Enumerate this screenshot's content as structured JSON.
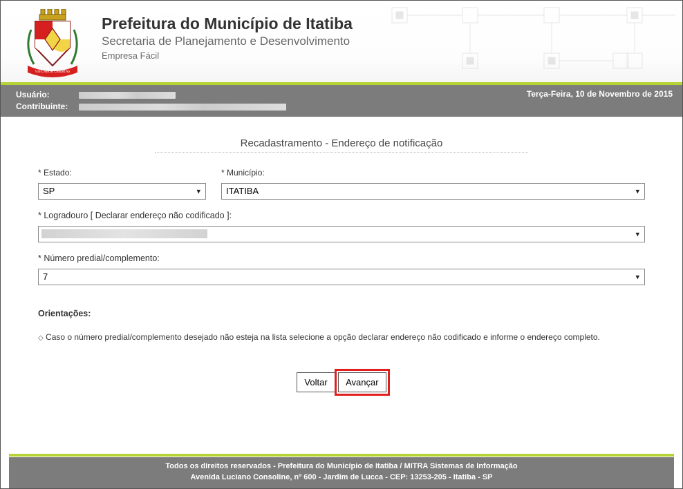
{
  "header": {
    "title": "Prefeitura do Município de Itatiba",
    "subtitle": "Secretaria de Planejamento e Desenvolvimento",
    "appname": "Empresa Fácil"
  },
  "userbar": {
    "user_label": "Usuário:",
    "contrib_label": "Contribuinte:",
    "date_text": "Terça-Feira, 10 de Novembro de 2015"
  },
  "page": {
    "title": "Recadastramento - Endereço de notificação"
  },
  "form": {
    "estado_label": "* Estado:",
    "estado_value": "SP",
    "municipio_label": "* Município:",
    "municipio_value": "ITATIBA",
    "logradouro_label": "* Logradouro [ Declarar endereço não codificado ]:",
    "logradouro_value": "",
    "numero_label": "* Número predial/complemento:",
    "numero_value": "7"
  },
  "orientacoes": {
    "heading": "Orientações:",
    "text": "Caso o número predial/complemento desejado não esteja na lista selecione a opção declarar endereço não codificado e informe o endereço completo."
  },
  "buttons": {
    "voltar": "Voltar",
    "avancar": "Avançar"
  },
  "footer": {
    "line1": "Todos os direitos reservados - Prefeitura do Município de Itatiba / MITRA Sistemas de Informação",
    "line2": "Avenida Luciano Consoline, nº 600 - Jardim de Lucca - CEP: 13253-205 - Itatiba - SP"
  }
}
